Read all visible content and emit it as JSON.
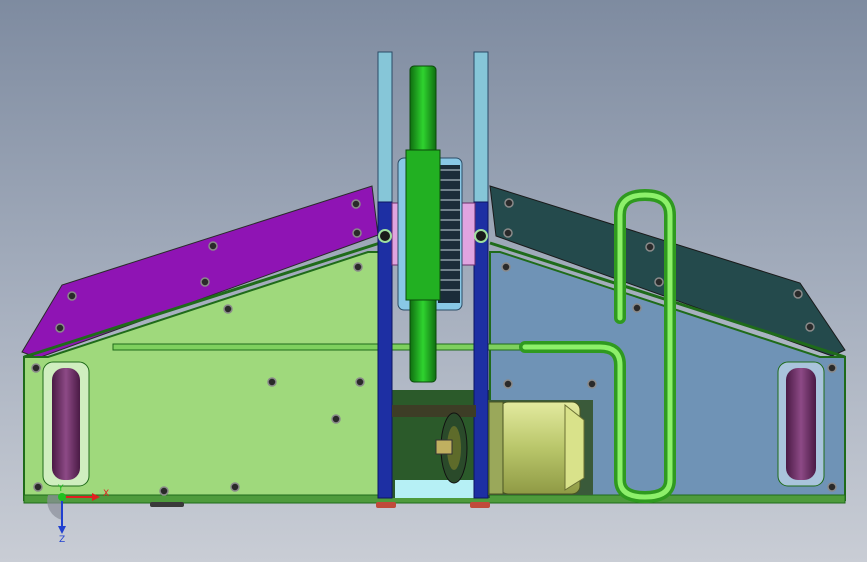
{
  "viewport": {
    "background_top": "#7e8ba0",
    "background_bottom": "#c9cdd5"
  },
  "colors": {
    "left_panel": "#9fd97c",
    "right_panel": "#6f93b6",
    "left_roof": "#8f14b4",
    "right_roof": "#244a4c",
    "frame_green": "#1f6b1a",
    "upright_blue": "#1d2fa3",
    "upright_light": "#86c6d8",
    "wheel_green": "#1fb41f",
    "pulley_blue": "#89c8e6",
    "pipe_green": "#5de03a",
    "motor_yellow": "#c8d47a",
    "track_purple": "#6c2b66"
  },
  "triad": {
    "x_label": "X",
    "y_label": "Y",
    "z_label": "Z",
    "x_color": "#e02020",
    "y_color": "#20c020",
    "z_color": "#2040d0"
  },
  "parts": [
    {
      "name": "left-side-panel",
      "icon": "panel-icon"
    },
    {
      "name": "right-side-panel",
      "icon": "panel-icon"
    },
    {
      "name": "left-roof-plate",
      "icon": "plate-icon"
    },
    {
      "name": "right-roof-plate",
      "icon": "plate-icon"
    },
    {
      "name": "weapon-disc",
      "icon": "disc-icon"
    },
    {
      "name": "drive-motor",
      "icon": "motor-icon"
    },
    {
      "name": "coolant-pipe",
      "icon": "pipe-icon"
    },
    {
      "name": "left-track-wheel",
      "icon": "wheel-icon"
    },
    {
      "name": "right-track-wheel",
      "icon": "wheel-icon"
    }
  ]
}
